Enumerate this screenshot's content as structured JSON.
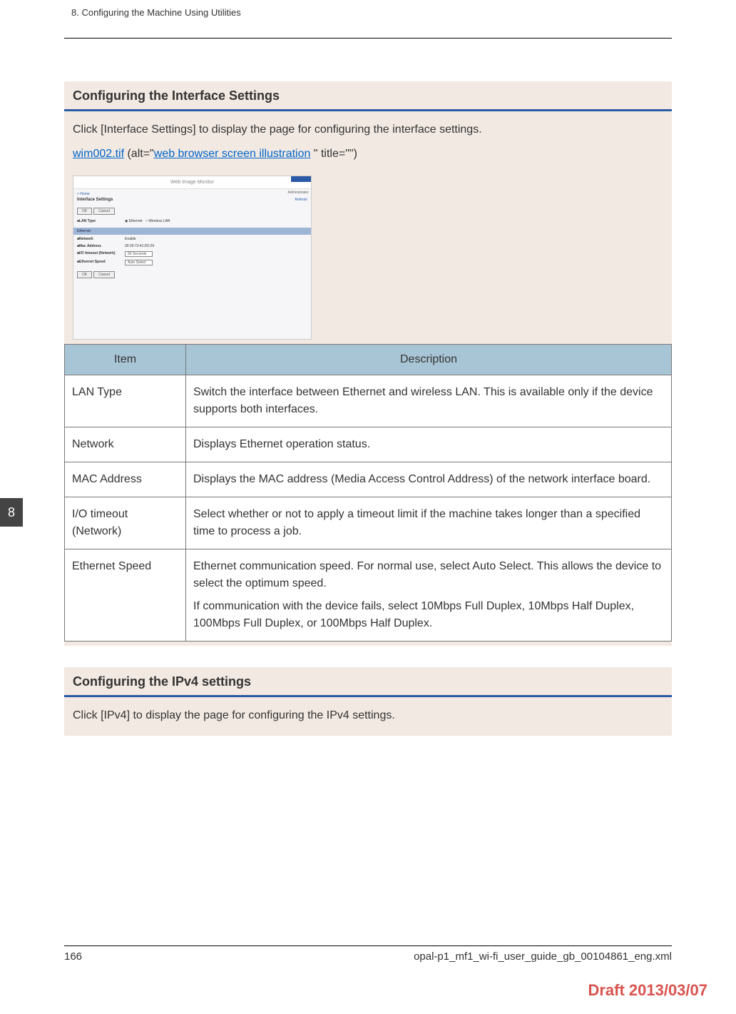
{
  "header": {
    "chapter": "8. Configuring the Machine Using Utilities"
  },
  "sidebar": {
    "chapter_number": "8"
  },
  "section1": {
    "title": "Configuring the Interface Settings",
    "intro": "Click [Interface Settings] to display the page for configuring the interface settings.",
    "img_ref_file": "wim002.tif",
    "img_ref_alt_pre": " (alt=\"",
    "img_ref_alt_link": "web browser screen illustration",
    "img_ref_alt_post": " \" title=\"\")"
  },
  "screenshot": {
    "app_title": "Web Image Monitor",
    "home": "< Home",
    "admin": "Administrator",
    "page_title": "Interface Settings",
    "refresh": "Refresh",
    "ok": "OK",
    "cancel": "Cancel",
    "lan_label": "■LAN Type",
    "lan_opt1": "Ethernet",
    "lan_opt2": "Wireless LAN",
    "eth_header": "Ethernet",
    "net_label": "■Network",
    "net_val": "Enable",
    "mac_label": "■Mac Address",
    "mac_val": "00:26:73:41:D0:29",
    "io_label": "■I/O timeout (Network)",
    "io_val": "60 Seconds",
    "spd_label": "■Ethernet Speed",
    "spd_val": "Auto Select"
  },
  "table": {
    "head_item": "Item",
    "head_desc": "Description",
    "rows": [
      {
        "item": "LAN Type",
        "desc": "Switch the interface between Ethernet and wireless LAN. This is available only if the device supports both interfaces."
      },
      {
        "item": "Network",
        "desc": "Displays Ethernet operation status."
      },
      {
        "item": "MAC Address",
        "desc": "Displays the MAC address (Media Access Control Address) of the network interface board."
      },
      {
        "item": "I/O timeout (Network)",
        "desc": "Select whether or not to apply a timeout limit if the machine takes longer than a specified time to process a job."
      },
      {
        "item": "Ethernet Speed",
        "desc1": "Ethernet communication speed. For normal use, select Auto Select. This allows the device to select the optimum speed.",
        "desc2": "If communication with the device fails, select 10Mbps Full Duplex, 10Mbps Half Duplex, 100Mbps Full Duplex, or 100Mbps Half Duplex."
      }
    ]
  },
  "section2": {
    "title": "Configuring the IPv4 settings",
    "intro": "Click [IPv4] to display the page for configuring the IPv4 settings."
  },
  "footer": {
    "page_number": "166",
    "doc_ref": "opal-p1_mf1_wi-fi_user_guide_gb_00104861_eng.xml",
    "draft": "Draft 2013/03/07"
  }
}
